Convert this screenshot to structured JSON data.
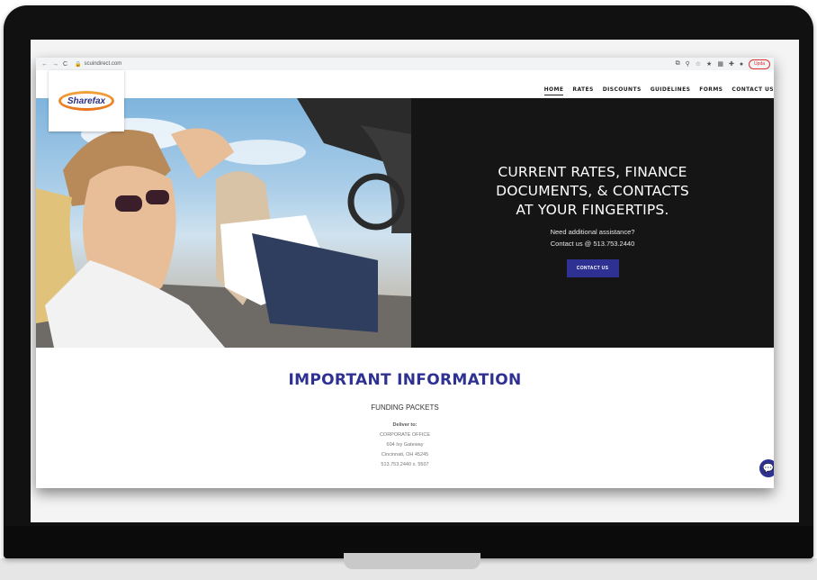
{
  "browser": {
    "url": "scuindirect.com",
    "update_label": "Upda"
  },
  "logo": {
    "text": "Sharefax"
  },
  "nav": {
    "items": [
      {
        "label": "HOME",
        "active": true
      },
      {
        "label": "RATES",
        "active": false
      },
      {
        "label": "DISCOUNTS",
        "active": false
      },
      {
        "label": "GUIDELINES",
        "active": false
      },
      {
        "label": "FORMS",
        "active": false
      },
      {
        "label": "CONTACT US",
        "active": false
      }
    ]
  },
  "hero": {
    "title_line1": "CURRENT RATES, FINANCE",
    "title_line2": "DOCUMENTS, & CONTACTS",
    "title_line3": "AT YOUR FINGERTIPS.",
    "sub_line1": "Need additional assistance?",
    "sub_line2": "Contact us @ 513.753.2440",
    "button_label": "CONTACT US"
  },
  "info": {
    "title": "IMPORTANT INFORMATION",
    "section": "FUNDING PACKETS",
    "deliver_label": "Deliver to:",
    "address": [
      "CORPORATE OFFICE",
      "604 Ivy Gateway",
      "Cincinnati, OH 45245",
      "513.753.2440 x. 5507"
    ]
  },
  "colors": {
    "accent": "#2e3192",
    "hero_dark": "#151515",
    "logo_orange": "#e9731d"
  },
  "icons": [
    "back-icon",
    "forward-icon",
    "reload-icon",
    "lock-icon",
    "share-icon",
    "zoom-icon",
    "bookmark-icon",
    "star-icon",
    "extension-icon",
    "puzzle-icon",
    "profile-icon",
    "chat-icon"
  ]
}
